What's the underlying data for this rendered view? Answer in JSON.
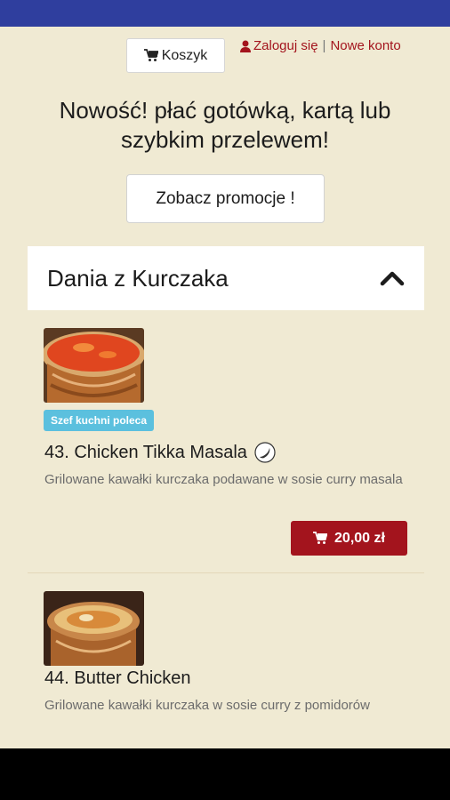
{
  "header": {
    "cart_label": "Koszyk",
    "login_label": "Zaloguj się",
    "separator": "|",
    "register_label": "Nowe konto"
  },
  "promo": {
    "text": "Nowość! płać gotówką, kartą lub szybkim przelewem!",
    "button_label": "Zobacz promocje !"
  },
  "category": {
    "title": "Dania z Kurczaka"
  },
  "items": [
    {
      "badge": "Szef kuchni poleca",
      "name": "43. Chicken Tikka Masala",
      "description": "Grilowane kawałki kurczaka podawane w sosie curry masala",
      "price": "20,00 zł",
      "icon": "chili-icon"
    },
    {
      "name": "44. Butter Chicken",
      "description": "Grilowane kawałki kurczaka w sosie curry z pomidorów"
    }
  ],
  "colors": {
    "topbar": "#2f3e9e",
    "accent": "#a3141d",
    "badge": "#5bc0de",
    "background": "#f0ead3"
  }
}
